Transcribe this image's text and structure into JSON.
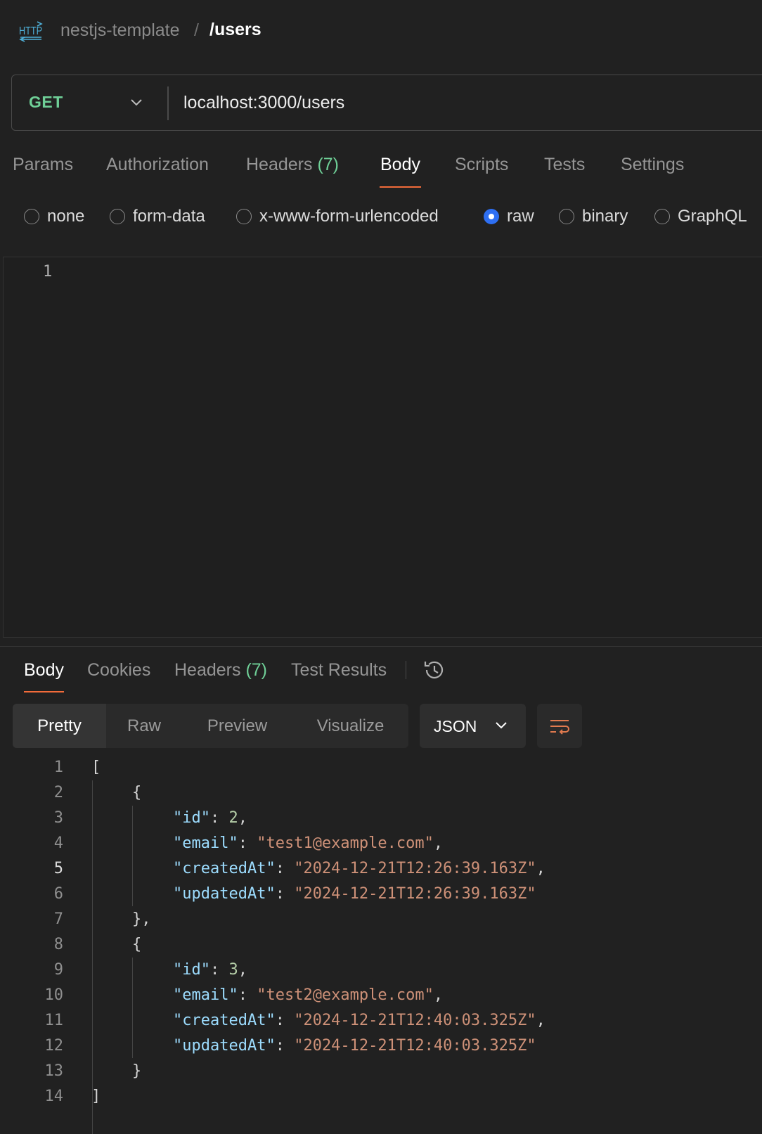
{
  "breadcrumb": {
    "icon": "http-icon",
    "parent": "nestjs-template",
    "separator": "/",
    "current": "/users"
  },
  "request": {
    "method": "GET",
    "method_color": "#6fcf97",
    "url": "localhost:3000/users",
    "tabs": [
      {
        "label": "Params"
      },
      {
        "label": "Authorization"
      },
      {
        "label": "Headers",
        "count": "(7)"
      },
      {
        "label": "Body",
        "active": true
      },
      {
        "label": "Scripts"
      },
      {
        "label": "Tests"
      },
      {
        "label": "Settings"
      }
    ],
    "body_types": [
      {
        "label": "none",
        "checked": false
      },
      {
        "label": "form-data",
        "checked": false
      },
      {
        "label": "x-www-form-urlencoded",
        "checked": false
      },
      {
        "label": "raw",
        "checked": true
      },
      {
        "label": "binary",
        "checked": false
      },
      {
        "label": "GraphQL",
        "checked": false
      }
    ],
    "editor": {
      "line_numbers": [
        "1"
      ]
    }
  },
  "response": {
    "tabs": [
      {
        "label": "Body",
        "active": true
      },
      {
        "label": "Cookies"
      },
      {
        "label": "Headers",
        "count": "(7)"
      },
      {
        "label": "Test Results"
      }
    ],
    "history_icon": "history-icon",
    "view_modes": [
      "Pretty",
      "Raw",
      "Preview",
      "Visualize"
    ],
    "active_view": "Pretty",
    "format": "JSON",
    "wrap_icon": "wrap-lines-icon",
    "code": {
      "line_numbers": [
        "1",
        "2",
        "3",
        "4",
        "5",
        "6",
        "7",
        "8",
        "9",
        "10",
        "11",
        "12",
        "13",
        "14"
      ],
      "active_line": "5",
      "users": [
        {
          "id": "2",
          "email": "\"test1@example.com\"",
          "createdAt": "\"2024-12-21T12:26:39.163Z\"",
          "updatedAt": "\"2024-12-21T12:26:39.163Z\""
        },
        {
          "id": "3",
          "email": "\"test2@example.com\"",
          "createdAt": "\"2024-12-21T12:40:03.325Z\"",
          "updatedAt": "\"2024-12-21T12:40:03.325Z\""
        }
      ],
      "keys": {
        "id": "\"id\"",
        "email": "\"email\"",
        "createdAt": "\"createdAt\"",
        "updatedAt": "\"updatedAt\""
      },
      "punct": {
        "open_array": "[",
        "close_array": "]",
        "open_obj": "{",
        "close_obj_comma": "},",
        "close_obj": "}"
      }
    }
  },
  "colors": {
    "accent": "#f26b3a",
    "count_green": "#6fcf97",
    "radio_blue": "#2e6ff2",
    "json_key": "#9cdcfe",
    "json_string": "#ce9178",
    "json_number": "#b5cea8"
  }
}
